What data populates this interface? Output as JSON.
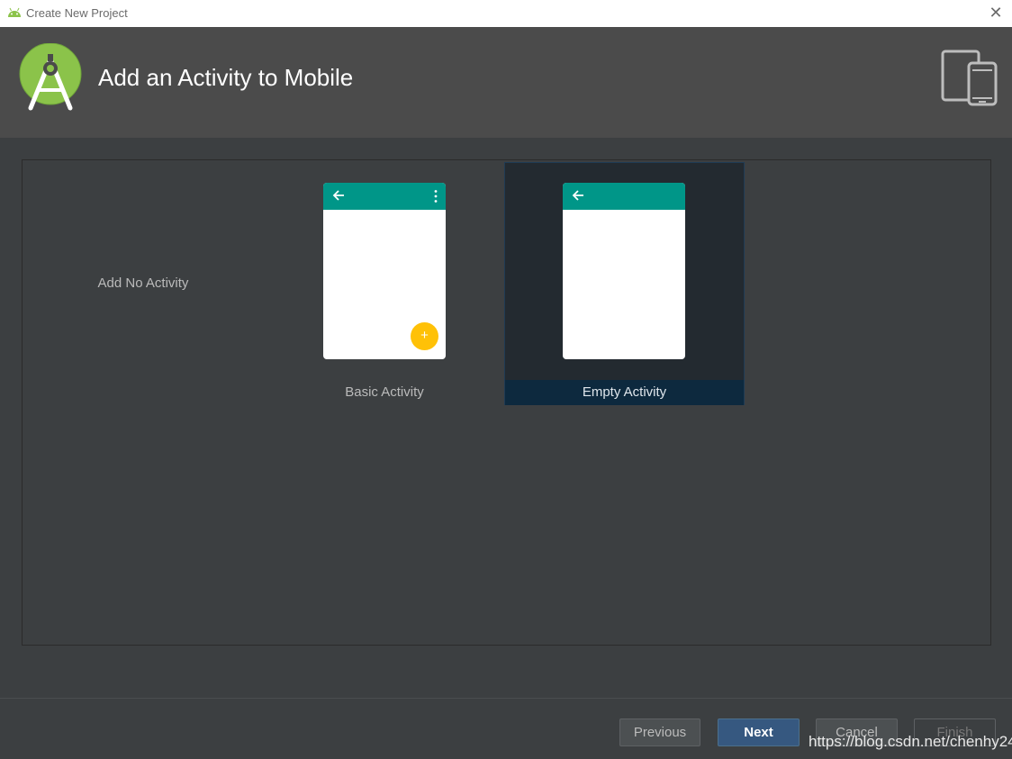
{
  "window": {
    "title": "Create New Project",
    "close_icon": "close-icon"
  },
  "header": {
    "heading": "Add an Activity to Mobile",
    "logo_icon": "android-studio-logo",
    "devices_icon": "tablet-phone-icon"
  },
  "gallery": {
    "selected": "Empty Activity",
    "items": [
      {
        "label": "Add No Activity"
      },
      {
        "label": "Basic Activity",
        "preview": {
          "toolbar_color": "#009688",
          "has_menu": true,
          "has_fab": true,
          "fab_color": "#ffc107",
          "fab_glyph": "+"
        }
      },
      {
        "label": "Empty Activity",
        "preview": {
          "toolbar_color": "#009688",
          "has_menu": false,
          "has_fab": false
        }
      }
    ]
  },
  "buttons": {
    "previous": "Previous",
    "next": "Next",
    "cancel": "Cancel",
    "finish": "Finish"
  },
  "watermark": "https://blog.csdn.net/chenhy24",
  "colors": {
    "header_bg": "#4b4b4b",
    "body_bg": "#3c3f41",
    "selection_bg": "#0d293e",
    "primary_button": "#365880"
  }
}
